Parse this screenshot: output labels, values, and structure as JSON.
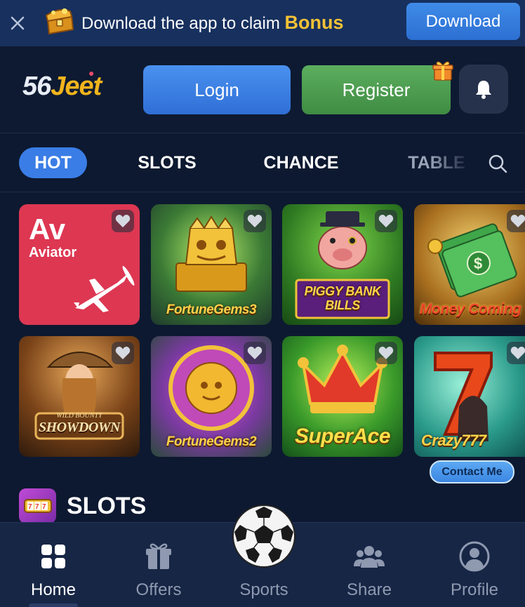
{
  "banner": {
    "message": "Download the app to claim",
    "bonus_label": "Bonus",
    "download_label": "Download"
  },
  "header": {
    "logo_number": "56",
    "logo_word": "Jeet",
    "login_label": "Login",
    "register_label": "Register"
  },
  "tabs": [
    {
      "label": "HOT",
      "active": true
    },
    {
      "label": "SLOTS",
      "active": false
    },
    {
      "label": "CHANCE",
      "active": false
    },
    {
      "label": "TABLE",
      "active": false
    }
  ],
  "games": [
    {
      "name": "Aviator",
      "logo_text": "Av"
    },
    {
      "name": "FortuneGems3"
    },
    {
      "name": "PIGGY BANK BILLS"
    },
    {
      "name": "Money Coming"
    },
    {
      "name": "SHOWDOWN",
      "subtitle": "WILD BOUNTY"
    },
    {
      "name": "FortuneGems2"
    },
    {
      "name": "SuperAce"
    },
    {
      "name": "Crazy777"
    }
  ],
  "contact_label": "Contact Me",
  "section": {
    "title": "SLOTS"
  },
  "bottom_nav": [
    {
      "label": "Home",
      "icon": "home-grid-icon",
      "active": true
    },
    {
      "label": "Offers",
      "icon": "gift-icon",
      "active": false
    },
    {
      "label": "Sports",
      "icon": "soccer-ball-icon",
      "active": false
    },
    {
      "label": "Share",
      "icon": "share-people-icon",
      "active": false
    },
    {
      "label": "Profile",
      "icon": "profile-icon",
      "active": false
    }
  ],
  "colors": {
    "background": "#0d1930",
    "accent_blue": "#3a7de6",
    "register_green": "#4f9f52",
    "bonus_gold": "#f3c236",
    "aviator_red": "#dd3752"
  }
}
